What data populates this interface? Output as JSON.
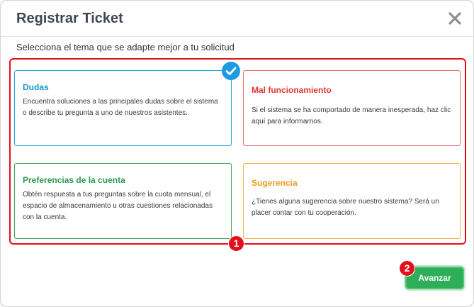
{
  "dialog": {
    "title": "Registrar Ticket",
    "subtitle": "Selecciona el tema que se adapte mejor a tu solicitud"
  },
  "options": [
    {
      "title": "Dudas",
      "description": "Encuentra soluciones a las principales dudas sobre el sistema o describe tu pregunta a uno de nuestros asistentes.",
      "color": "#1598cc",
      "selected": true
    },
    {
      "title": "Mal funcionamiento",
      "description": "Si el sistema se ha comportado de manera inesperada, haz clic aquí para informarnos.",
      "color": "#e03535",
      "selected": false
    },
    {
      "title": "Preferencias de la cuenta",
      "description": "Obtén respuesta a tus preguntas sobre la cuota mensual, el espacio de almacenamiento u otras cuestiones relacionadas con la cuenta.",
      "color": "#2e9a50",
      "selected": false
    },
    {
      "title": "Sugerencia",
      "description": "¿Tienes alguna sugerencia sobre nuestro sistema? Será un placer contar con tu cooperación.",
      "color": "#ee9a1a",
      "selected": false
    }
  ],
  "annotations": {
    "step1": "1",
    "step2": "2",
    "highlight_color": "#e3101b"
  },
  "footer": {
    "next_label": "Avanzar",
    "next_color": "#2fae5a"
  },
  "icons": {
    "close": "close-icon",
    "selected": "check-icon"
  }
}
